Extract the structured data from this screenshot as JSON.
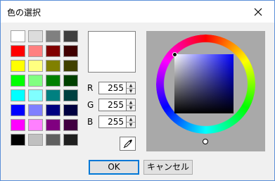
{
  "window": {
    "title": "色の選択"
  },
  "swatches": [
    [
      "#ffffff",
      "#dcdcdc",
      "#808080",
      "#404040"
    ],
    [
      "#ff0000",
      "#ff8080",
      "#800000",
      "#400000"
    ],
    [
      "#ffff00",
      "#ffff80",
      "#808000",
      "#404000"
    ],
    [
      "#00ff00",
      "#80ff80",
      "#008000",
      "#004000"
    ],
    [
      "#00ffff",
      "#80ffff",
      "#008080",
      "#004040"
    ],
    [
      "#0000ff",
      "#8080ff",
      "#000080",
      "#000040"
    ],
    [
      "#ff00ff",
      "#ff80ff",
      "#800080",
      "#400040"
    ],
    [
      "#000000",
      "#c0c0c0",
      "#606060",
      "#202020"
    ]
  ],
  "preview_color": "#ffffff",
  "fields": [
    {
      "label": "R",
      "value": "255"
    },
    {
      "label": "G",
      "value": "255"
    },
    {
      "label": "B",
      "value": "255"
    }
  ],
  "buttons": {
    "ok": "OK",
    "cancel": "キャンセル"
  },
  "icons": {
    "close": "close-icon",
    "eyedropper": "eyedropper-icon"
  }
}
